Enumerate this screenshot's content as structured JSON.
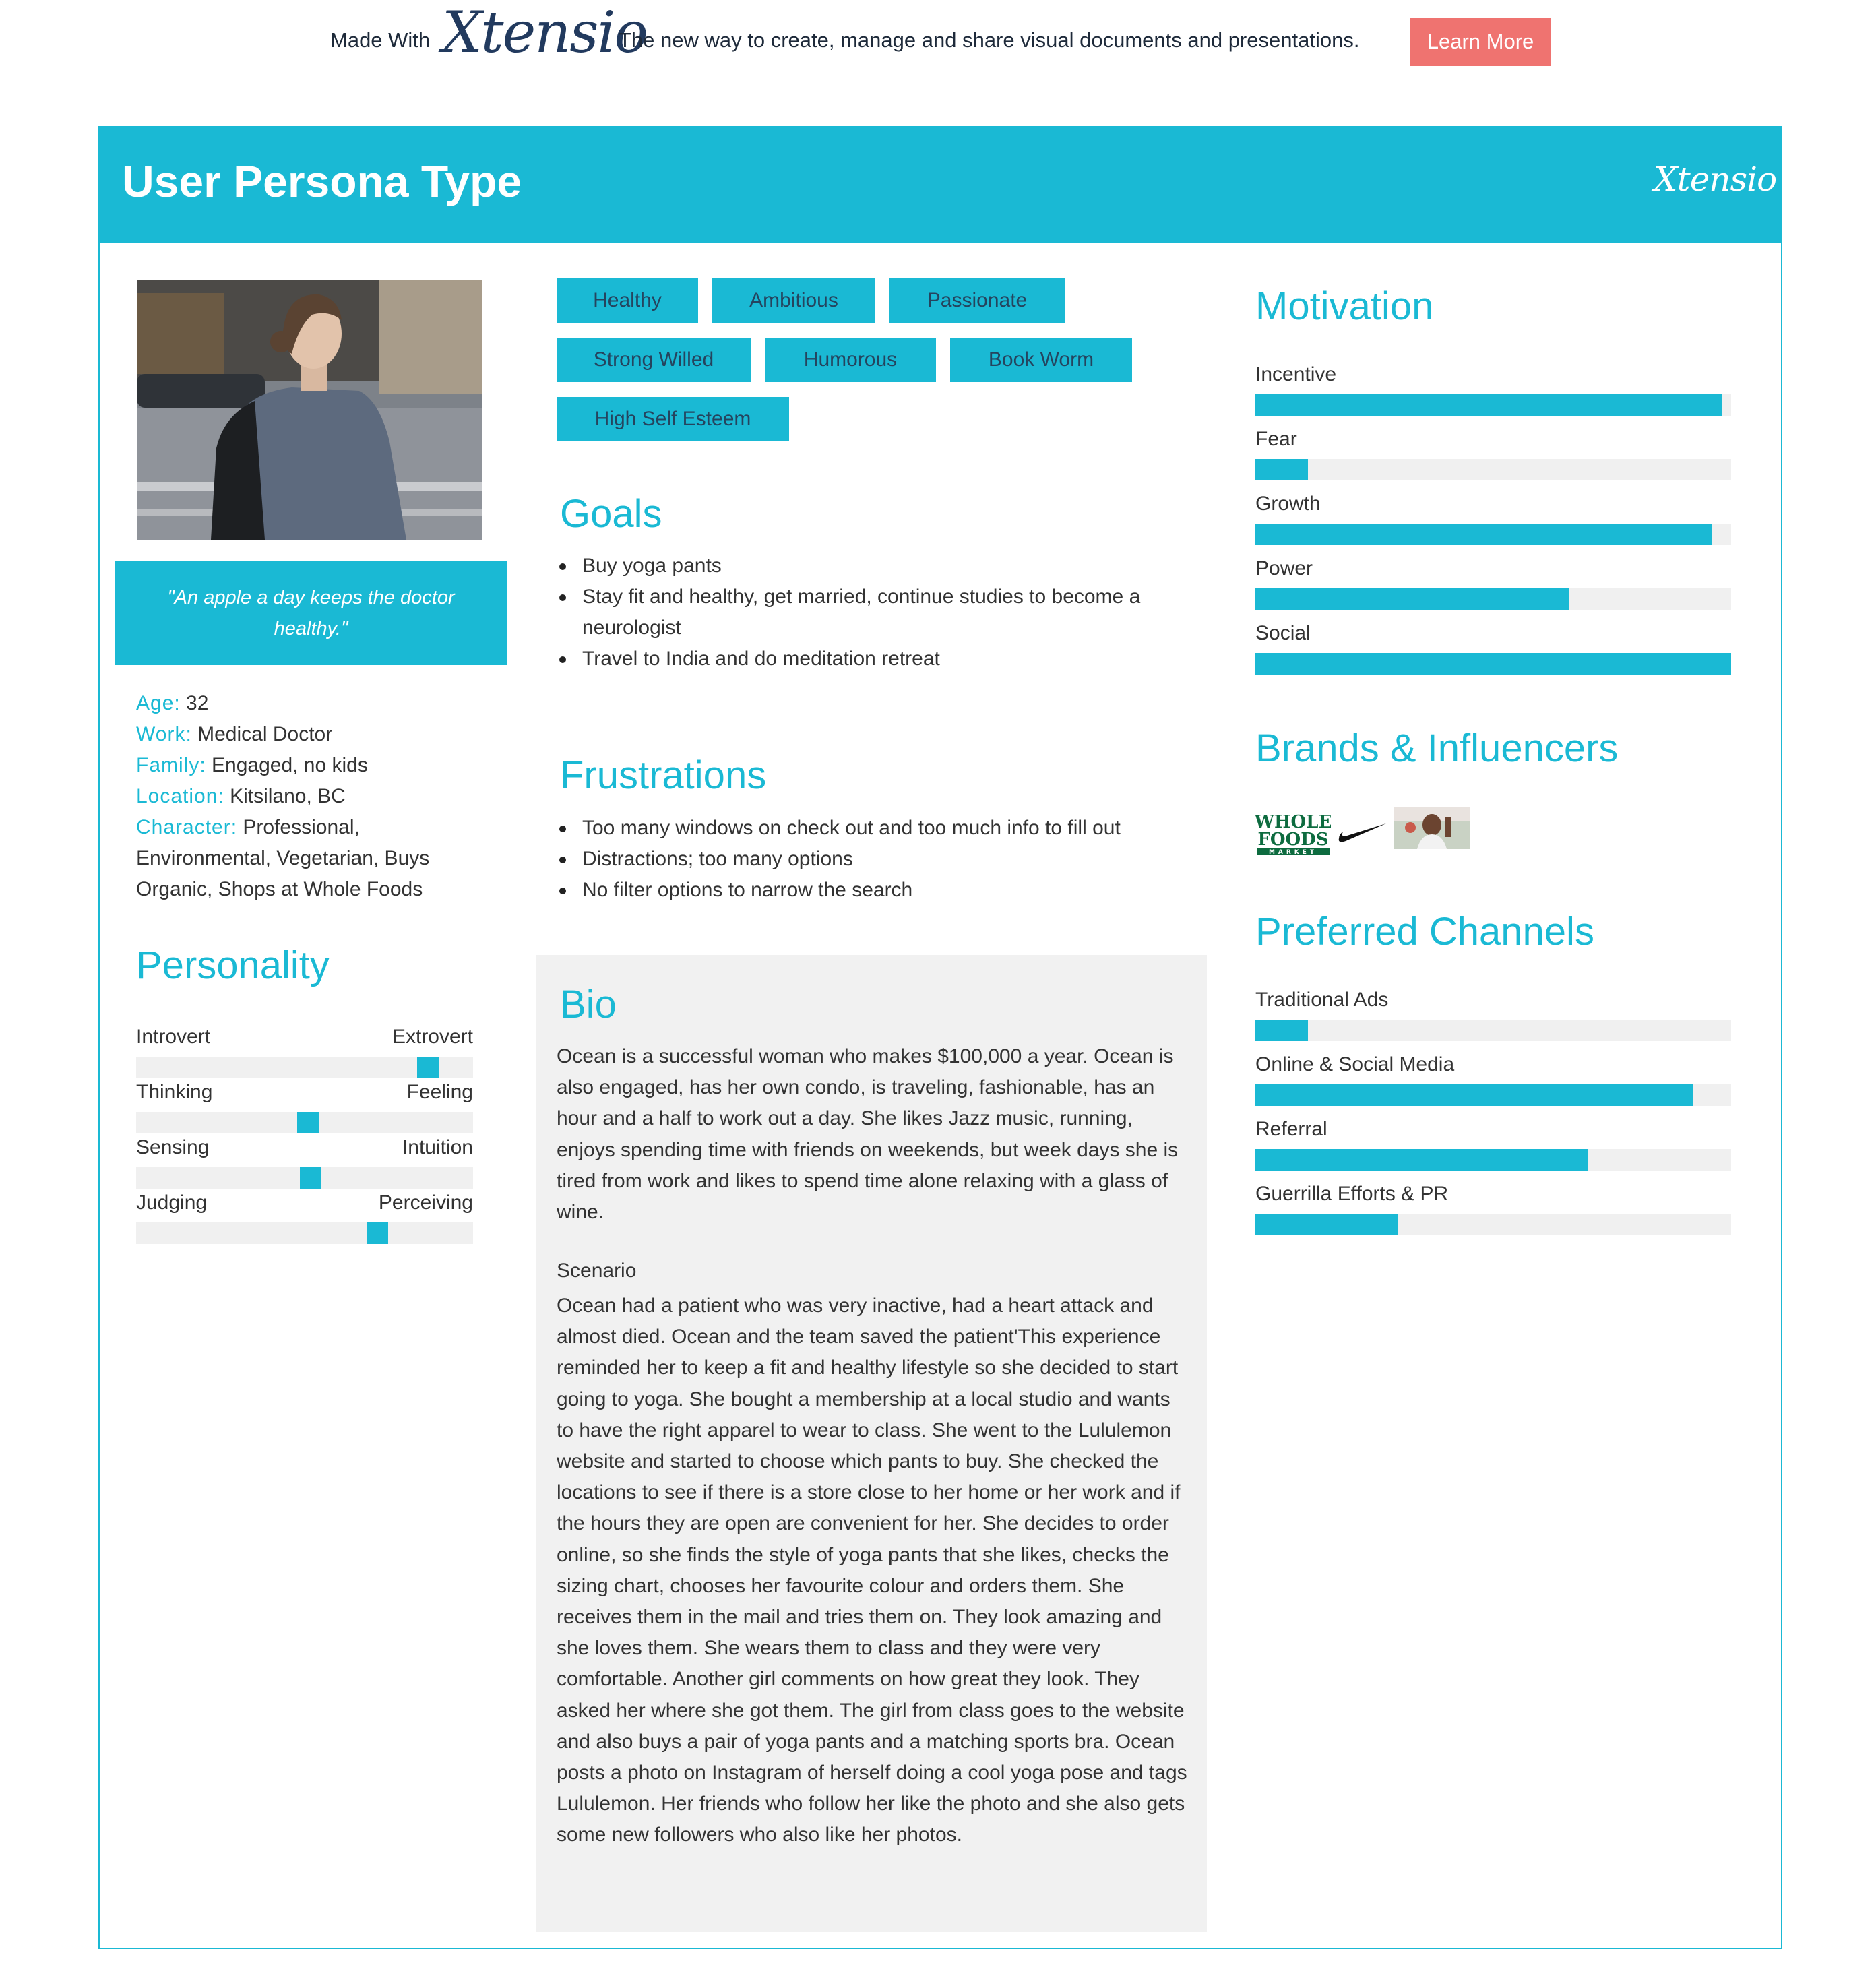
{
  "promo": {
    "made_with": "Made With",
    "logo_text": "Xtensio",
    "tagline": "The new way to create, manage and share visual documents and presentations.",
    "learn_more": "Learn More"
  },
  "header": {
    "title": "User Persona Type",
    "logo_text": "Xtensio"
  },
  "colors": {
    "accent": "#1ab9d4",
    "button": "#ef7370",
    "track": "#f0f0f0",
    "bio_bg": "#f1f1f1"
  },
  "quote": "\"An apple a day keeps the doctor healthy.\"",
  "facts": {
    "age_label": "Age:",
    "age": " 32",
    "work_label": "Work:",
    "work": " Medical Doctor",
    "family_label": "Family:",
    "family": " Engaged, no kids",
    "location_label": "Location:",
    "location": " Kitsilano, BC",
    "character_label": "Character:",
    "character": " Professional, Environmental, Vegetarian, Buys Organic, Shops at Whole Foods"
  },
  "personality": {
    "title": "Personality",
    "scales": [
      {
        "left": "Introvert",
        "right": "Extrovert",
        "value": 0.89
      },
      {
        "left": "Thinking",
        "right": "Feeling",
        "value": 0.51
      },
      {
        "left": "Sensing",
        "right": "Intuition",
        "value": 0.52
      },
      {
        "left": "Judging",
        "right": "Perceiving",
        "value": 0.73
      }
    ]
  },
  "traits": [
    "Healthy",
    "Ambitious",
    "Passionate",
    "Strong Willed",
    "Humorous",
    "Book Worm",
    "High Self Esteem"
  ],
  "goals": {
    "title": "Goals",
    "items": [
      "Buy yoga pants",
      "Stay fit and healthy, get married, continue studies to become a neurologist",
      "Travel to India and do meditation retreat"
    ]
  },
  "frustrations": {
    "title": "Frustrations",
    "items": [
      "Too many windows on check out and too much info to fill out",
      "Distractions; too many options",
      "No filter options to narrow the search"
    ]
  },
  "bio": {
    "title": "Bio",
    "text": "Ocean is a successful woman who makes $100,000 a year. Ocean is also engaged, has her own condo, is traveling, fashionable, has an hour and a half to work out a day. She likes Jazz music, running, enjoys spending time with friends on weekends, but week days she is tired from work and likes to spend time alone relaxing with a glass of wine.",
    "scenario_title": "Scenario",
    "scenario": "Ocean had a patient who was very inactive, had a heart attack and almost died. Ocean and the team saved the patient'This experience reminded her to keep a fit and healthy lifestyle so she decided to start going to yoga. She bought a membership at a local studio and wants to have the right apparel to wear to class. She went to the Lululemon website and started to choose which pants to buy. She checked the locations to see if there is a store close to her home or her work and if the hours they are open are convenient for her. She decides to order online, so she finds the style of yoga pants that she likes, checks the sizing chart, chooses her favourite colour and orders them. She receives them in the mail and tries them on. They look amazing and she loves them. She wears them to class and they were very comfortable. Another girl comments on how great they look. They asked her where she got them. The girl from class goes to the website and also buys a pair of yoga pants and a matching sports bra. Ocean posts a photo on Instagram of herself doing a cool yoga pose and tags Lululemon. Her friends who follow her like the photo and she also gets some new followers who also like her photos."
  },
  "motivation": {
    "title": "Motivation",
    "items": [
      {
        "label": "Incentive",
        "value": 0.98
      },
      {
        "label": "Fear",
        "value": 0.11
      },
      {
        "label": "Growth",
        "value": 0.96
      },
      {
        "label": "Power",
        "value": 0.66
      },
      {
        "label": "Social",
        "value": 1.0
      }
    ]
  },
  "brands": {
    "title": "Brands & Influencers",
    "logos": [
      "WHOLE",
      "FOODS",
      "MARKET"
    ],
    "icons": [
      "whole-foods-logo",
      "nike-swoosh-logo",
      "athlete-photo"
    ]
  },
  "channels": {
    "title": "Preferred Channels",
    "items": [
      {
        "label": "Traditional Ads",
        "value": 0.11
      },
      {
        "label": "Online & Social Media",
        "value": 0.92
      },
      {
        "label": "Referral",
        "value": 0.7
      },
      {
        "label": "Guerrilla Efforts & PR",
        "value": 0.3
      }
    ]
  }
}
